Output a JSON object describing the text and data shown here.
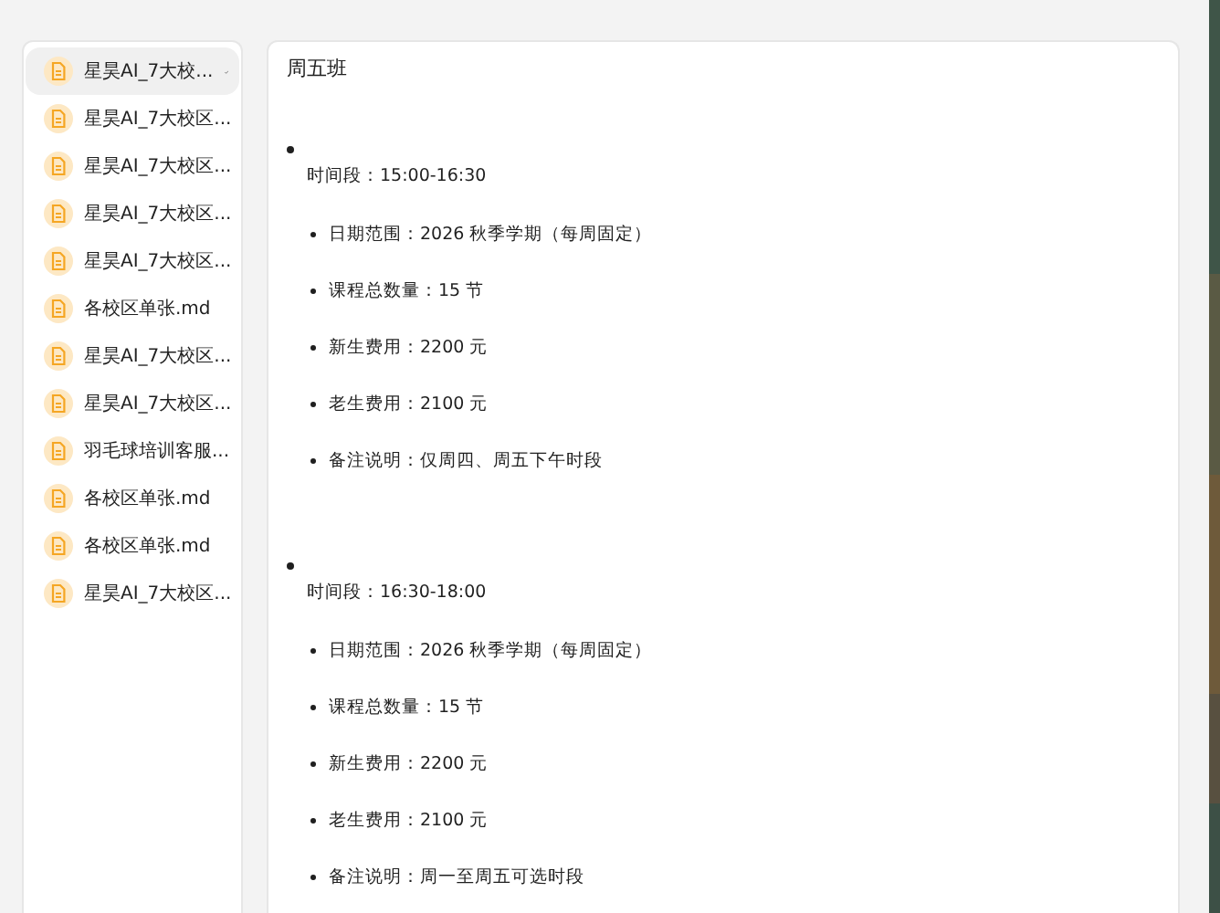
{
  "sidebar": {
    "items": [
      {
        "label": "星昊AI_7大校...",
        "selected": true
      },
      {
        "label": "星昊AI_7大校区...",
        "selected": false
      },
      {
        "label": "星昊AI_7大校区...",
        "selected": false
      },
      {
        "label": "星昊AI_7大校区...",
        "selected": false
      },
      {
        "label": "星昊AI_7大校区...",
        "selected": false
      },
      {
        "label": "各校区单张.md",
        "selected": false
      },
      {
        "label": "星昊AI_7大校区...",
        "selected": false
      },
      {
        "label": "星昊AI_7大校区...",
        "selected": false
      },
      {
        "label": "羽毛球培训客服...",
        "selected": false
      },
      {
        "label": "各校区单张.md",
        "selected": false
      },
      {
        "label": "各校区单张.md",
        "selected": false
      },
      {
        "label": "星昊AI_7大校区...",
        "selected": false
      }
    ]
  },
  "content": {
    "title": "周五班",
    "sections": [
      {
        "time": "时间段：15:00-16:30",
        "items": [
          "日期范围：2026 秋季学期（每周固定）",
          "课程总数量：15 节",
          "新生费用：2200 元",
          "老生费用：2100 元",
          "备注说明：仅周四、周五下午时段"
        ]
      },
      {
        "time": "时间段：16:30-18:00",
        "items": [
          "日期范围：2026 秋季学期（每周固定）",
          "课程总数量：15 节",
          "新生费用：2200 元",
          "老生费用：2100 元",
          "备注说明：周一至周五可选时段"
        ]
      }
    ]
  }
}
